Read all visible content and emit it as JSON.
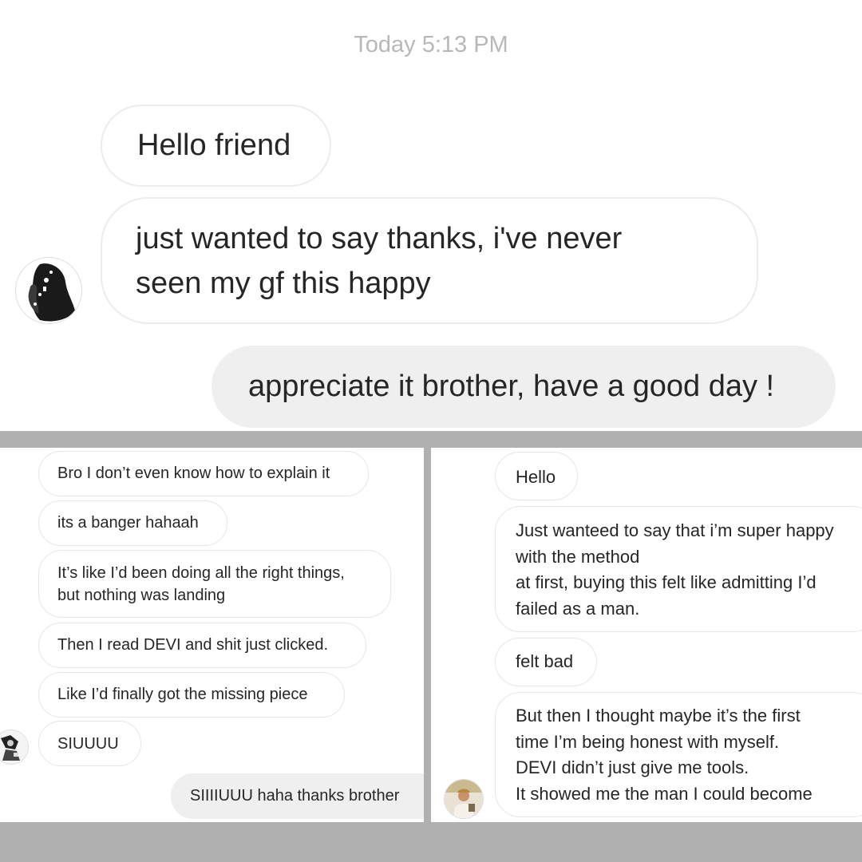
{
  "top": {
    "timestamp": "Today 5:13 PM",
    "messages": [
      {
        "text": "Hello friend",
        "from": "them"
      },
      {
        "text": "just wanted to say thanks, i've never\nseen my gf this happy",
        "from": "them"
      },
      {
        "text": "appreciate it brother, have a good day !",
        "from": "me"
      }
    ]
  },
  "bottom_left": {
    "messages": [
      {
        "text": "Bro I don’t even know how to explain it",
        "from": "them"
      },
      {
        "text": "its a banger hahaah",
        "from": "them"
      },
      {
        "text": "It’s like I’d been doing all the right things,\nbut nothing was landing",
        "from": "them"
      },
      {
        "text": "Then I read DEVI and shit just clicked.",
        "from": "them"
      },
      {
        "text": "Like I’d finally got the missing piece",
        "from": "them"
      },
      {
        "text": "SIUUUU",
        "from": "them"
      },
      {
        "text": "SIIIIUUU haha thanks brother",
        "from": "me"
      }
    ]
  },
  "bottom_right": {
    "messages": [
      {
        "text": "Hello",
        "from": "them"
      },
      {
        "text": "Just wanteed to say that i’m super happy\nwith the method\nat first, buying this felt like admitting I’d\nfailed as a man.",
        "from": "them"
      },
      {
        "text": "felt bad",
        "from": "them"
      },
      {
        "text": "But then I thought maybe it’s the first\ntime I’m being honest with myself.\nDEVI didn’t just give me tools.\nIt showed me the man I could become",
        "from": "them"
      }
    ]
  },
  "colors": {
    "incoming_bubble": "#ffffff",
    "incoming_border": "#ececec",
    "outgoing_bubble": "#efefef",
    "divider": "#b0b0b0",
    "timestamp": "#b8b8b8"
  }
}
